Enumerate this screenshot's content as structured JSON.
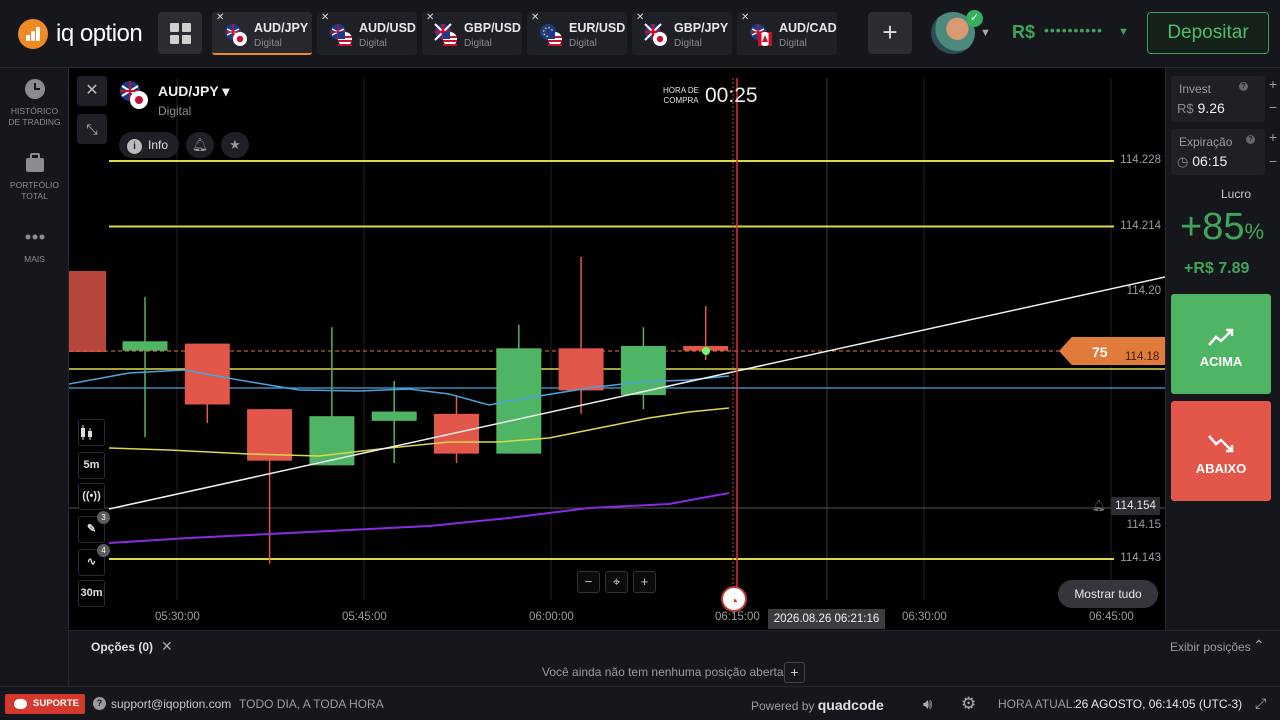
{
  "app": {
    "logo_text": "iq option"
  },
  "tabs": [
    {
      "pair": "AUD/JPY",
      "type": "Digital",
      "flags": [
        "au",
        "jp"
      ],
      "active": true
    },
    {
      "pair": "AUD/USD",
      "type": "Digital",
      "flags": [
        "au",
        "us"
      ],
      "active": false
    },
    {
      "pair": "GBP/USD",
      "type": "Digital",
      "flags": [
        "gb",
        "us"
      ],
      "active": false
    },
    {
      "pair": "EUR/USD",
      "type": "Digital",
      "flags": [
        "eu",
        "us"
      ],
      "active": false
    },
    {
      "pair": "GBP/JPY",
      "type": "Digital",
      "flags": [
        "gb",
        "jp"
      ],
      "active": false
    },
    {
      "pair": "AUD/CAD",
      "type": "Digital",
      "flags": [
        "au",
        "ca"
      ],
      "active": false
    }
  ],
  "header": {
    "balance_currency": "R$",
    "balance_mask": "••••••••••",
    "deposit_label": "Depositar"
  },
  "sidebar": {
    "items": [
      {
        "label": "HISTÓRICO DE TRADING",
        "icon": "clock-icon"
      },
      {
        "label": "PORTFÓLIO TOTAL",
        "icon": "briefcase-icon"
      },
      {
        "label": "MAIS",
        "icon": "dots-icon"
      }
    ]
  },
  "chart": {
    "asset_name": "AUD/JPY",
    "asset_type": "Digital",
    "info_label": "Info",
    "buy_time_label": "HORA DE COMPRA",
    "buy_time_value": "00:25",
    "timeframe_label": "5m",
    "candle_period_label": "30m",
    "drawing_badge": "3",
    "indicator_badge": "4",
    "show_all_label": "Mostrar tudo",
    "current_date": "2026.08.26 06:21:16",
    "current_price": "114.18",
    "current_price_last": "75",
    "alert_price": "114.154",
    "zoom_out": "−",
    "zoom_reset": "⌖",
    "zoom_in": "+"
  },
  "chart_data": {
    "type": "candlestick",
    "price_levels": [
      "114.228",
      "114.214",
      "114.20",
      "114.15",
      "114.143"
    ],
    "time_labels": [
      "05:30:00",
      "05:45:00",
      "06:00:00",
      "06:15:00",
      "06:30:00",
      "06:45:00"
    ],
    "candles": [
      {
        "o": 114.1875,
        "h": 114.199,
        "l": 114.169,
        "c": 114.1895,
        "dir": "up"
      },
      {
        "o": 114.189,
        "h": 114.182,
        "l": 114.172,
        "c": 114.176,
        "dir": "down"
      },
      {
        "o": 114.175,
        "h": 114.175,
        "l": 114.142,
        "c": 114.164,
        "dir": "down"
      },
      {
        "o": 114.163,
        "h": 114.1925,
        "l": 114.163,
        "c": 114.1735,
        "dir": "up"
      },
      {
        "o": 114.1725,
        "h": 114.181,
        "l": 114.1635,
        "c": 114.1745,
        "dir": "up"
      },
      {
        "o": 114.174,
        "h": 114.178,
        "l": 114.1635,
        "c": 114.1655,
        "dir": "down"
      },
      {
        "o": 114.1655,
        "h": 114.193,
        "l": 114.1655,
        "c": 114.188,
        "dir": "up"
      },
      {
        "o": 114.188,
        "h": 114.2075,
        "l": 114.174,
        "c": 114.179,
        "dir": "down"
      },
      {
        "o": 114.178,
        "h": 114.1925,
        "l": 114.175,
        "c": 114.1885,
        "dir": "up"
      },
      {
        "o": 114.1885,
        "h": 114.197,
        "l": 114.1855,
        "c": 114.1875,
        "dir": "down"
      }
    ]
  },
  "right_panel": {
    "invest_label": "Invest",
    "invest_currency": "R$",
    "invest_value": "9.26",
    "expiry_label": "Expiração",
    "expiry_value": "06:15",
    "profit_label": "Lucro",
    "profit_pct": "+85",
    "profit_pct_sign": "%",
    "profit_value": "+R$ 7.89",
    "up_label": "ACIMA",
    "down_label": "ABAIXO"
  },
  "options": {
    "label": "Opções (0)",
    "no_positions": "Você ainda não tem nenhuma posição aberta",
    "show_positions": "Exibir posições"
  },
  "footer": {
    "support_label": "SUPORTE",
    "support_email": "support@iqoption.com",
    "support_hours": "TODO DIA, A TODA HORA",
    "powered_by": "Powered by",
    "powered_brand": "quadcode",
    "time_label": "HORA ATUAL:",
    "time_value": "26 AGOSTO, 06:14:05 (UTC-3)"
  },
  "colors": {
    "up": "#4fb464",
    "down": "#e3564a",
    "accent": "#f08a24",
    "level_line": "#d9d94a",
    "ma_blue": "#4aa3df",
    "ma_yellow": "#d9d94a",
    "ma_purple": "#8a2be2"
  }
}
